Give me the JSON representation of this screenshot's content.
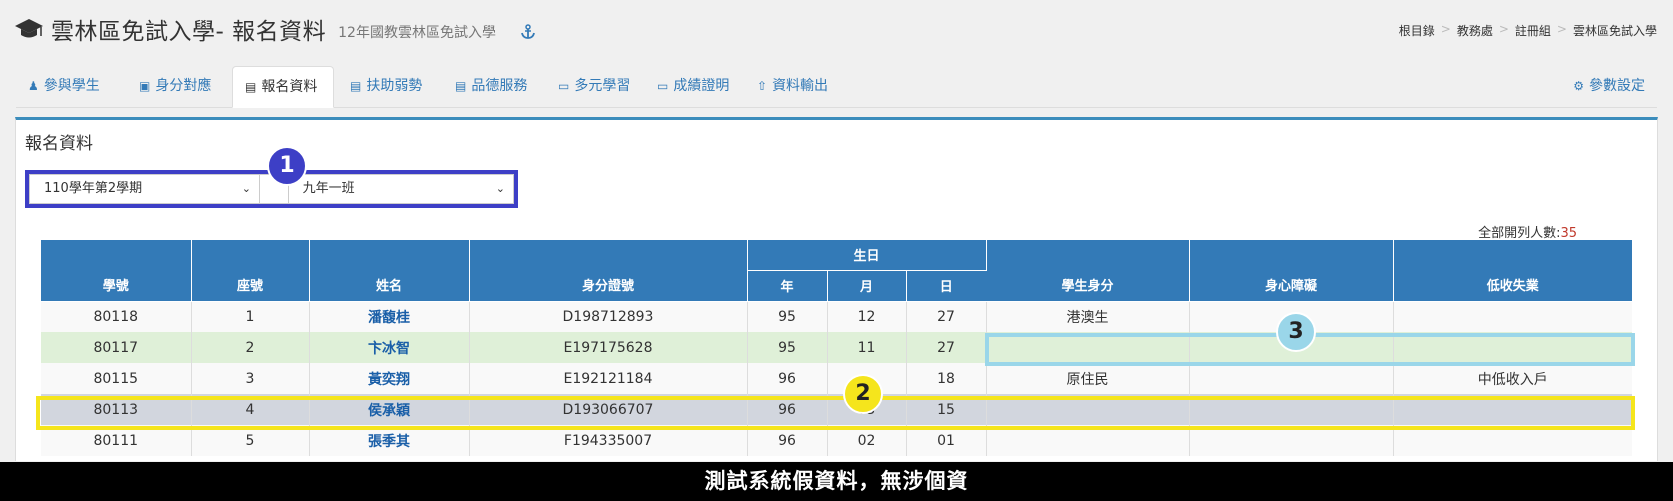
{
  "header": {
    "title": "雲林區免試入學- 報名資料",
    "subtitle": "12年國教雲林區免試入學",
    "icon": "graduation-cap-icon",
    "breadcrumb": [
      "根目錄",
      "教務處",
      "註冊組",
      "雲林區免試入學"
    ]
  },
  "tabs": [
    {
      "label": "參與學生",
      "icon": "user-plus-icon"
    },
    {
      "label": "身分對應",
      "icon": "id-badge-icon"
    },
    {
      "label": "報名資料",
      "icon": "id-card-icon",
      "active": true
    },
    {
      "label": "扶助弱勢",
      "icon": "id-card-icon"
    },
    {
      "label": "品德服務",
      "icon": "id-card-icon"
    },
    {
      "label": "多元學習",
      "icon": "book-icon"
    },
    {
      "label": "成績證明",
      "icon": "book-icon"
    },
    {
      "label": "資料輸出",
      "icon": "upload-icon"
    }
  ],
  "settings_tab": {
    "label": "參數設定",
    "icon": "gear-icon"
  },
  "panel": {
    "title": "報名資料",
    "semester_select": "110學年第2學期",
    "class_select": "九年一班",
    "count_label": "全部開列人數:",
    "count_value": "35"
  },
  "table": {
    "headers": {
      "id": "學號",
      "seat": "座號",
      "name": "姓名",
      "idno": "身分證號",
      "birthday": "生日",
      "year": "年",
      "month": "月",
      "day": "日",
      "identity": "學生身分",
      "disability": "身心障礙",
      "low_income": "低收失業"
    },
    "rows": [
      {
        "id": "80118",
        "seat": "1",
        "name": "潘馥桂",
        "idno": "D198712893",
        "year": "95",
        "month": "12",
        "day": "27",
        "identity": "港澳生",
        "disability": "",
        "low_income": ""
      },
      {
        "id": "80117",
        "seat": "2",
        "name": "卞冰智",
        "idno": "E197175628",
        "year": "95",
        "month": "11",
        "day": "27",
        "identity": "",
        "disability": "",
        "low_income": ""
      },
      {
        "id": "80115",
        "seat": "3",
        "name": "黃奕翔",
        "idno": "E192121184",
        "year": "96",
        "month": "",
        "day": "18",
        "identity": "原住民",
        "disability": "",
        "low_income": "中低收入戶"
      },
      {
        "id": "80113",
        "seat": "4",
        "name": "侯承穎",
        "idno": "D193066707",
        "year": "96",
        "month": "05",
        "day": "15",
        "identity": "",
        "disability": "",
        "low_income": ""
      },
      {
        "id": "80111",
        "seat": "5",
        "name": "張季其",
        "idno": "F194335007",
        "year": "96",
        "month": "02",
        "day": "01",
        "identity": "",
        "disability": "",
        "low_income": ""
      }
    ]
  },
  "annotations": {
    "badge1": "1",
    "badge2": "2",
    "badge3": "3"
  },
  "footer_banner": "測試系統假資料，無涉個資",
  "colors": {
    "primary": "#337ab7",
    "annotation_blue": "#3d3fc6",
    "annotation_yellow": "#f5e51c",
    "annotation_cyan": "#9ad6e9"
  }
}
